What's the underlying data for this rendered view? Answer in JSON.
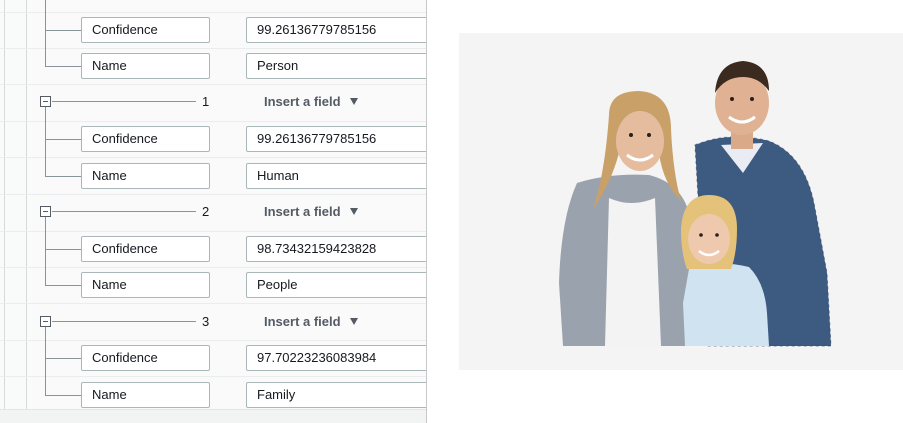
{
  "labels": [
    {
      "fields": [
        {
          "key": "Confidence",
          "value": "99.26136779785156"
        },
        {
          "key": "Name",
          "value": "Person"
        }
      ]
    },
    {
      "index": "1",
      "insert_label": "Insert a field",
      "fields": [
        {
          "key": "Confidence",
          "value": "99.26136779785156"
        },
        {
          "key": "Name",
          "value": "Human"
        }
      ]
    },
    {
      "index": "2",
      "insert_label": "Insert a field",
      "fields": [
        {
          "key": "Confidence",
          "value": "98.73432159423828"
        },
        {
          "key": "Name",
          "value": "People"
        }
      ]
    },
    {
      "index": "3",
      "insert_label": "Insert a field",
      "fields": [
        {
          "key": "Confidence",
          "value": "97.70223236083984"
        },
        {
          "key": "Name",
          "value": "Family"
        }
      ]
    }
  ],
  "image": {
    "subject": "family-photo",
    "background": "#f4f4f4"
  }
}
